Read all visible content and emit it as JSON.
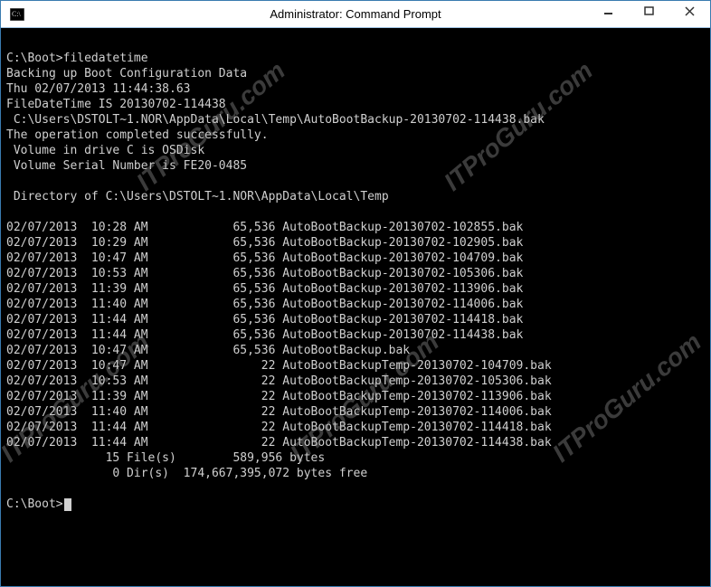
{
  "window": {
    "title": "Administrator: Command Prompt"
  },
  "terminal": {
    "prompt1_path": "C:\\Boot>",
    "prompt1_cmd": "filedatetime",
    "line_backup": "Backing up Boot Configuration Data",
    "line_date": "Thu 02/07/2013 11:44:38.63",
    "line_fdt": "FileDateTime IS 20130702-114438",
    "line_bakpath": " C:\\Users\\DSTOLT~1.NOR\\AppData\\Local\\Temp\\AutoBootBackup-20130702-114438.bak",
    "line_success": "The operation completed successfully.",
    "line_vol": " Volume in drive C is OSDisk",
    "line_serial": " Volume Serial Number is FE20-0485",
    "line_dirof": " Directory of C:\\Users\\DSTOLT~1.NOR\\AppData\\Local\\Temp",
    "files": [
      {
        "date": "02/07/2013",
        "time": "10:28 AM",
        "size": "65,536",
        "name": "AutoBootBackup-20130702-102855.bak"
      },
      {
        "date": "02/07/2013",
        "time": "10:29 AM",
        "size": "65,536",
        "name": "AutoBootBackup-20130702-102905.bak"
      },
      {
        "date": "02/07/2013",
        "time": "10:47 AM",
        "size": "65,536",
        "name": "AutoBootBackup-20130702-104709.bak"
      },
      {
        "date": "02/07/2013",
        "time": "10:53 AM",
        "size": "65,536",
        "name": "AutoBootBackup-20130702-105306.bak"
      },
      {
        "date": "02/07/2013",
        "time": "11:39 AM",
        "size": "65,536",
        "name": "AutoBootBackup-20130702-113906.bak"
      },
      {
        "date": "02/07/2013",
        "time": "11:40 AM",
        "size": "65,536",
        "name": "AutoBootBackup-20130702-114006.bak"
      },
      {
        "date": "02/07/2013",
        "time": "11:44 AM",
        "size": "65,536",
        "name": "AutoBootBackup-20130702-114418.bak"
      },
      {
        "date": "02/07/2013",
        "time": "11:44 AM",
        "size": "65,536",
        "name": "AutoBootBackup-20130702-114438.bak"
      },
      {
        "date": "02/07/2013",
        "time": "10:47 AM",
        "size": "65,536",
        "name": "AutoBootBackup.bak"
      },
      {
        "date": "02/07/2013",
        "time": "10:47 AM",
        "size": "22",
        "name": "AutoBootBackupTemp-20130702-104709.bak"
      },
      {
        "date": "02/07/2013",
        "time": "10:53 AM",
        "size": "22",
        "name": "AutoBootBackupTemp-20130702-105306.bak"
      },
      {
        "date": "02/07/2013",
        "time": "11:39 AM",
        "size": "22",
        "name": "AutoBootBackupTemp-20130702-113906.bak"
      },
      {
        "date": "02/07/2013",
        "time": "11:40 AM",
        "size": "22",
        "name": "AutoBootBackupTemp-20130702-114006.bak"
      },
      {
        "date": "02/07/2013",
        "time": "11:44 AM",
        "size": "22",
        "name": "AutoBootBackupTemp-20130702-114418.bak"
      },
      {
        "date": "02/07/2013",
        "time": "11:44 AM",
        "size": "22",
        "name": "AutoBootBackupTemp-20130702-114438.bak"
      }
    ],
    "summary_files": "              15 File(s)        589,956 bytes",
    "summary_dirs": "               0 Dir(s)  174,667,395,072 bytes free",
    "prompt2_path": "C:\\Boot>"
  },
  "watermark": "ITProGuru.com"
}
